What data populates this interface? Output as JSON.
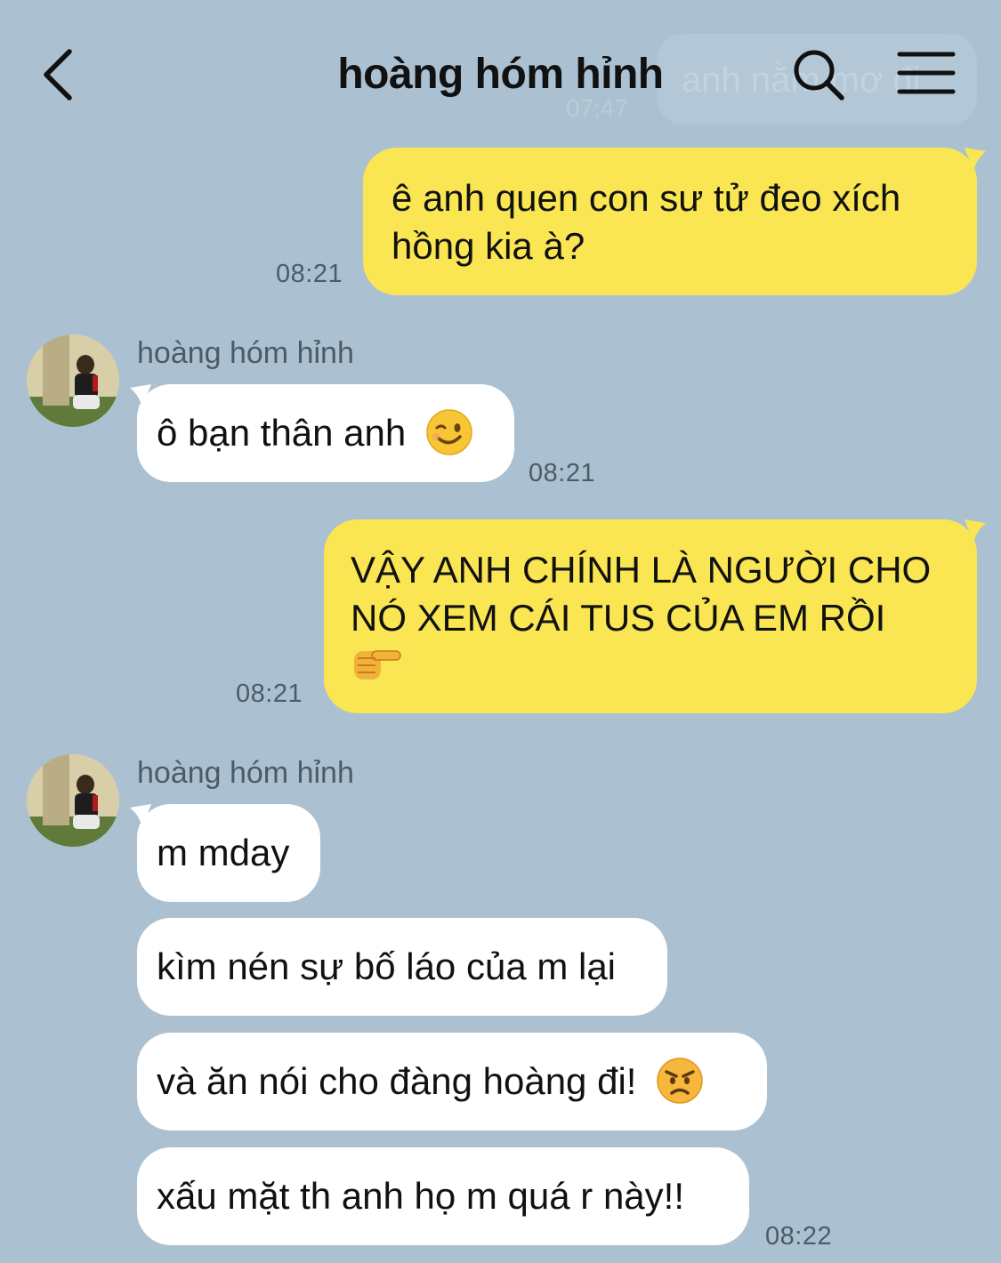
{
  "header": {
    "title": "hoàng hóm hỉnh",
    "back_icon": "chevron-left-icon",
    "search_icon": "search-icon",
    "menu_icon": "hamburger-menu-icon"
  },
  "ghost_message": {
    "text": "anh nằm mơ đi",
    "time": "07:47"
  },
  "contact": {
    "name": "hoàng hóm hỉnh"
  },
  "messages": [
    {
      "side": "me",
      "text": "ê anh quen con sư tử đeo xích\nhồng kia à?",
      "time": "08:21"
    },
    {
      "side": "them",
      "text": "ô bạn thân anh",
      "emoji": "winking-face",
      "time": "08:21"
    },
    {
      "side": "me",
      "text": "VẬY ANH CHÍNH LÀ NGƯỜI CHO\nNÓ XEM CÁI TUS CỦA EM RỒI",
      "emoji": "backhand-index-pointing-right",
      "time": "08:21"
    },
    {
      "side": "them",
      "text": "m mday"
    },
    {
      "side": "them",
      "text": "kìm nén sự bố láo của m lại"
    },
    {
      "side": "them",
      "text": "và ăn nói cho đàng hoàng đi!",
      "emoji": "angry-face"
    },
    {
      "side": "them",
      "text": "xấu mặt th anh họ m quá r này!!",
      "time": "08:22"
    }
  ],
  "colors": {
    "background": "#abc1d1",
    "my_bubble": "#fae653",
    "their_bubble": "#ffffff",
    "timestamp": "#4d5b66"
  }
}
